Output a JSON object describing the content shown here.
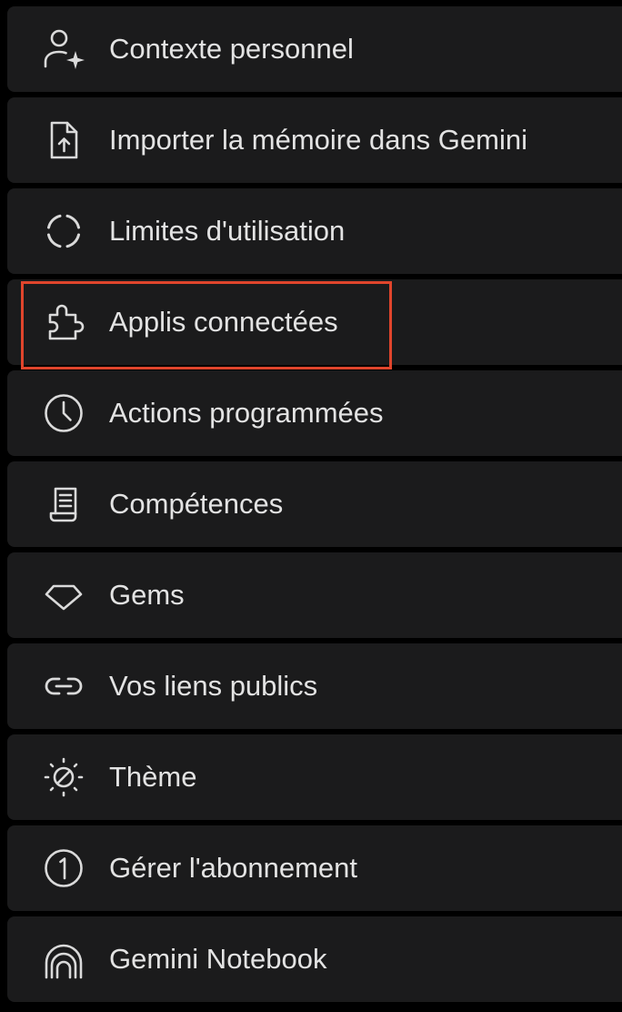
{
  "menu": {
    "items": [
      {
        "label": "Contexte personnel",
        "icon": "person-sparkle-icon"
      },
      {
        "label": "Importer la mémoire dans Gemini",
        "icon": "file-upload-icon"
      },
      {
        "label": "Limites d'utilisation",
        "icon": "circle-progress-icon"
      },
      {
        "label": "Applis connectées",
        "icon": "puzzle-icon",
        "highlighted": true
      },
      {
        "label": "Actions programmées",
        "icon": "clock-icon"
      },
      {
        "label": "Compétences",
        "icon": "scroll-icon"
      },
      {
        "label": "Gems",
        "icon": "gem-icon"
      },
      {
        "label": "Vos liens publics",
        "icon": "link-icon"
      },
      {
        "label": "Thème",
        "icon": "theme-icon"
      },
      {
        "label": "Gérer l'abonnement",
        "icon": "subscription-icon"
      },
      {
        "label": "Gemini Notebook",
        "icon": "notebook-icon"
      }
    ]
  },
  "colors": {
    "background": "#000000",
    "item_background": "#1b1b1c",
    "text": "#e3e3e3",
    "icon": "#dadada",
    "highlight": "#e0452c"
  }
}
